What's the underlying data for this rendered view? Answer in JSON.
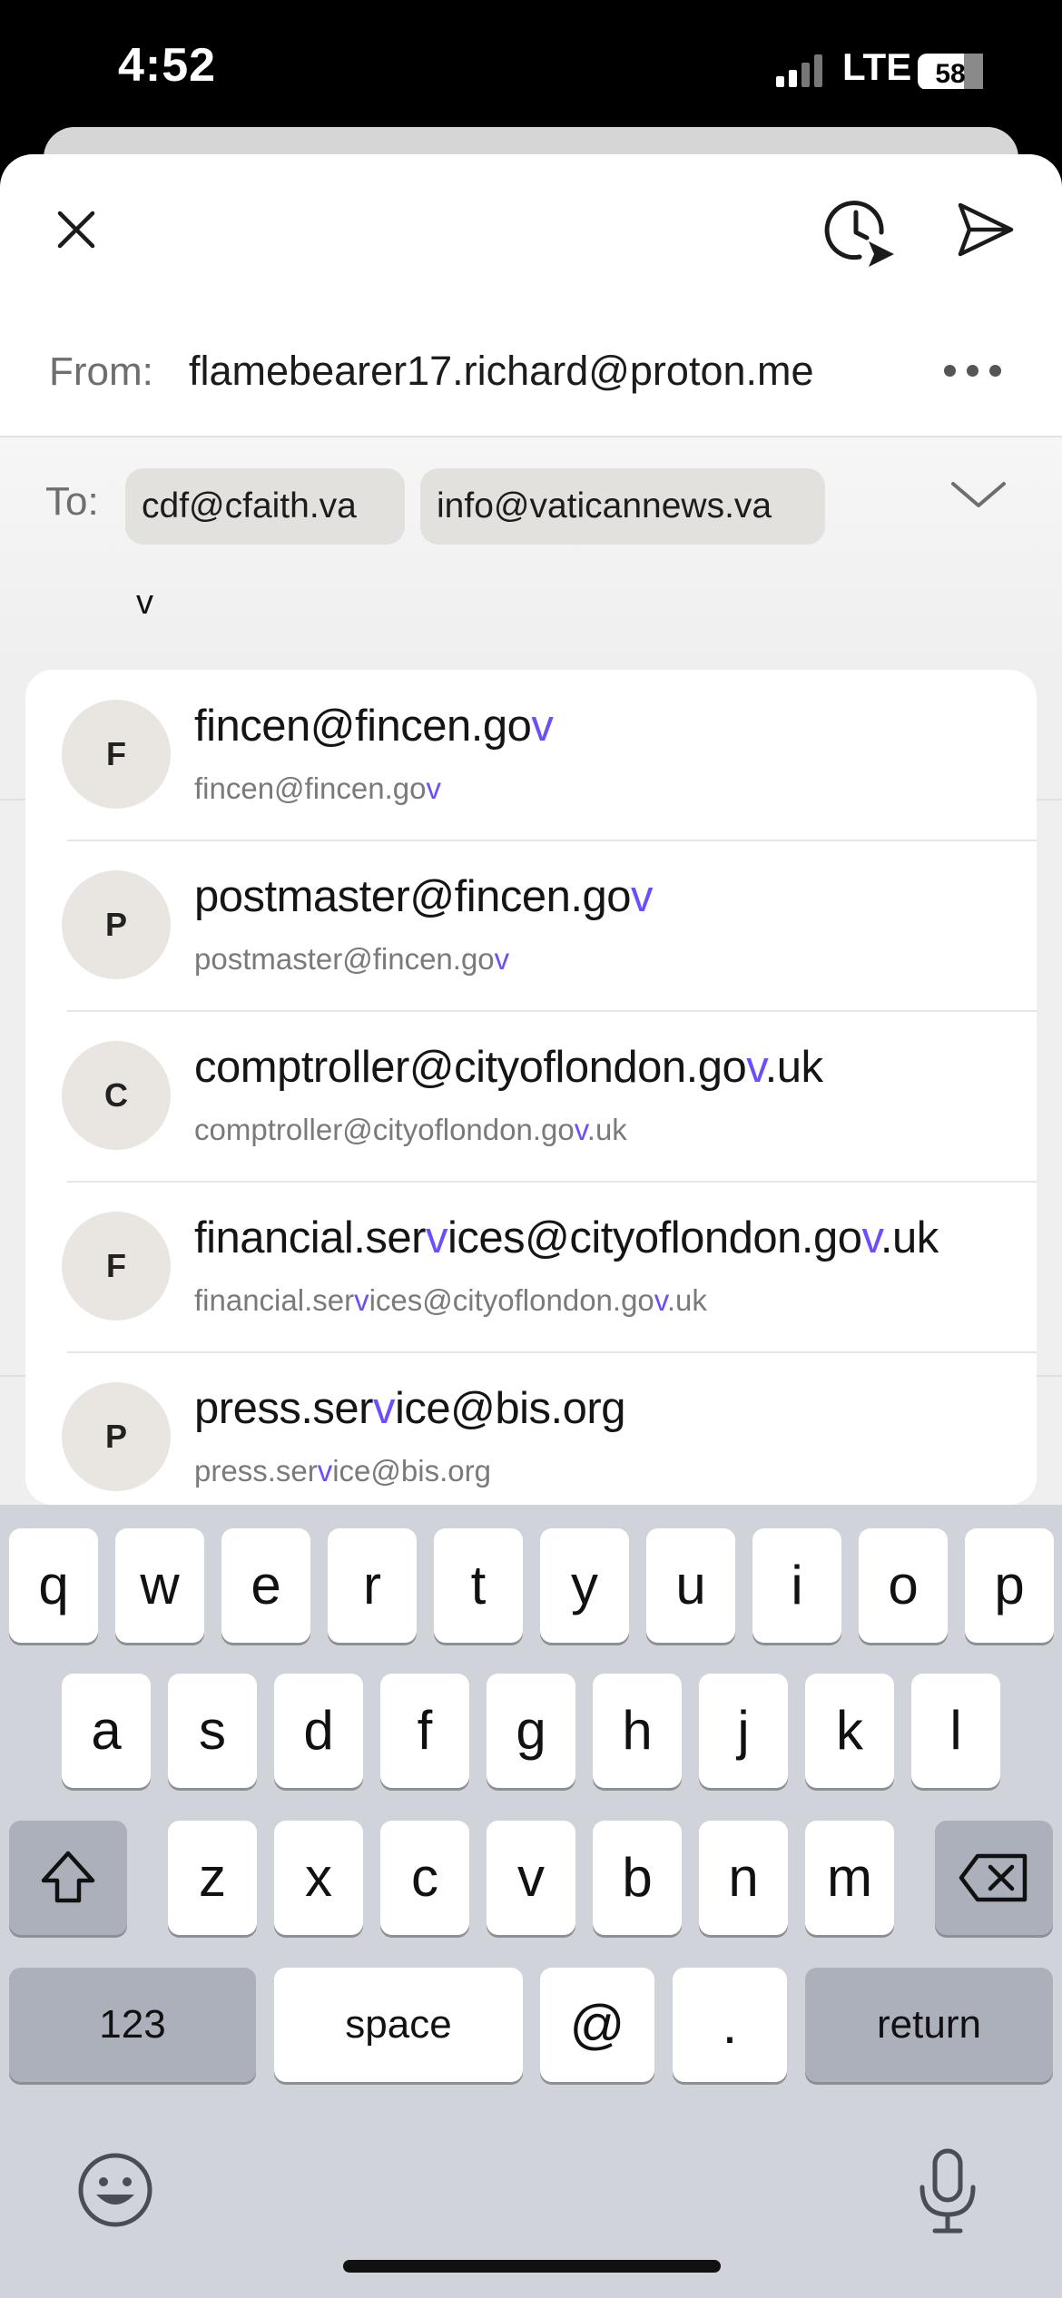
{
  "status_bar": {
    "time": "4:52",
    "network": "LTE",
    "battery": "58"
  },
  "compose": {
    "from_label": "From:",
    "from_address": "flamebearer17.richard@proton.me",
    "to_label": "To:",
    "recipients": [
      "cdf@cfaith.va",
      "info@vaticannews.va"
    ],
    "to_input_value": "v"
  },
  "suggestions": [
    {
      "initial": "F",
      "title": [
        "fincen@fincen.go",
        "v",
        ""
      ],
      "subtitle": [
        "fincen@fincen.go",
        "v",
        ""
      ]
    },
    {
      "initial": "P",
      "title": [
        "postmaster@fincen.go",
        "v",
        ""
      ],
      "subtitle": [
        "postmaster@fincen.go",
        "v",
        ""
      ]
    },
    {
      "initial": "C",
      "title": [
        "comptroller@cityoflondon.go",
        "v",
        ".uk"
      ],
      "subtitle": [
        "comptroller@cityoflondon.go",
        "v",
        ".uk"
      ]
    },
    {
      "initial": "F",
      "title": [
        "financial.ser",
        "v",
        "ices@cityoflondon.go",
        "v",
        ".uk"
      ],
      "subtitle": [
        "financial.ser",
        "v",
        "ices@cityoflondon.go",
        "v",
        ".uk"
      ]
    },
    {
      "initial": "P",
      "title": [
        "press.ser",
        "v",
        "ice@bis.org"
      ],
      "subtitle": [
        "press.ser",
        "v",
        "ice@bis.org"
      ]
    }
  ],
  "keyboard": {
    "row1": [
      "q",
      "w",
      "e",
      "r",
      "t",
      "y",
      "u",
      "i",
      "o",
      "p"
    ],
    "row2": [
      "a",
      "s",
      "d",
      "f",
      "g",
      "h",
      "j",
      "k",
      "l"
    ],
    "row3": [
      "z",
      "x",
      "c",
      "v",
      "b",
      "n",
      "m"
    ],
    "numbers": "123",
    "space": "space",
    "at": "@",
    "dot": ".",
    "return": "return"
  },
  "colors": {
    "highlight": "#6e4cff",
    "chip": "#e3e1de",
    "avatar": "#e9e6e2"
  },
  "icons": [
    "close-icon",
    "schedule-send-icon",
    "send-icon",
    "more-icon",
    "chevron-down-icon",
    "shift-icon",
    "backspace-icon",
    "emoji-icon",
    "microphone-icon"
  ]
}
